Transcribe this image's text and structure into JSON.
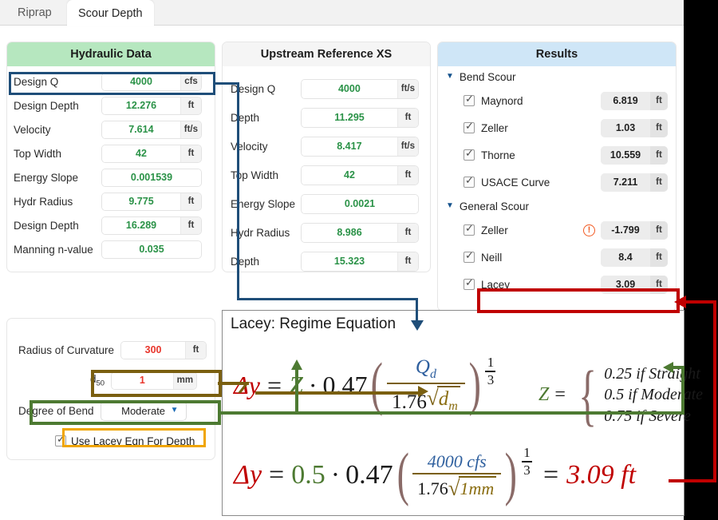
{
  "window": {
    "tabs": [
      {
        "label": "Riprap",
        "active": false
      },
      {
        "label": "Scour Depth",
        "active": true
      }
    ]
  },
  "hydraulic_panel": {
    "title": "Hydraulic Data",
    "header_color": "#b6e7bf",
    "rows": [
      {
        "label": "Design Q",
        "value": "4000",
        "unit": "cfs"
      },
      {
        "label": "Design Depth",
        "value": "12.276",
        "unit": "ft"
      },
      {
        "label": "Velocity",
        "value": "7.614",
        "unit": "ft/s"
      },
      {
        "label": "Top Width",
        "value": "42",
        "unit": "ft"
      },
      {
        "label": "Energy Slope",
        "value": "0.001539",
        "unit": ""
      },
      {
        "label": "Hydr Radius",
        "value": "9.775",
        "unit": "ft"
      },
      {
        "label": "Design Depth",
        "value": "16.289",
        "unit": "ft"
      },
      {
        "label": "Manning n-value",
        "value": "0.035",
        "unit": ""
      }
    ]
  },
  "upstream_panel": {
    "title": "Upstream Reference XS",
    "header_color": "#f5f5f5",
    "rows": [
      {
        "label": "Design Q",
        "value": "4000",
        "unit": "ft/s"
      },
      {
        "label": "Depth",
        "value": "11.295",
        "unit": "ft"
      },
      {
        "label": "Velocity",
        "value": "8.417",
        "unit": "ft/s"
      },
      {
        "label": "Top Width",
        "value": "42",
        "unit": "ft"
      },
      {
        "label": "Energy Slope",
        "value": "0.0021",
        "unit": ""
      },
      {
        "label": "Hydr Radius",
        "value": "8.986",
        "unit": "ft"
      },
      {
        "label": "Depth",
        "value": "15.323",
        "unit": "ft"
      }
    ]
  },
  "results_panel": {
    "title": "Results",
    "header_color": "#cfe6f7",
    "groups": [
      {
        "name": "Bend Scour",
        "expanded": true,
        "items": [
          {
            "label": "Maynord",
            "checked": true,
            "value": "6.819",
            "unit": "ft",
            "warning": false
          },
          {
            "label": "Zeller",
            "checked": true,
            "value": "1.03",
            "unit": "ft",
            "warning": false
          },
          {
            "label": "Thorne",
            "checked": true,
            "value": "10.559",
            "unit": "ft",
            "warning": false
          },
          {
            "label": "USACE Curve",
            "checked": true,
            "value": "7.211",
            "unit": "ft",
            "warning": false
          }
        ]
      },
      {
        "name": "General Scour",
        "expanded": true,
        "items": [
          {
            "label": "Zeller",
            "checked": true,
            "value": "-1.799",
            "unit": "ft",
            "warning": true
          },
          {
            "label": "Neill",
            "checked": true,
            "value": "8.4",
            "unit": "ft",
            "warning": false
          },
          {
            "label": "Lacey",
            "checked": true,
            "value": "3.09",
            "unit": "ft",
            "warning": false
          }
        ]
      }
    ]
  },
  "bend_panel": {
    "radius_label": "Radius of Curvature",
    "radius_value": "300",
    "radius_unit": "ft",
    "d50_label": "d",
    "d50_sub": "50",
    "d50_value": "1",
    "d50_unit": "mm",
    "degree_label": "Degree of Bend",
    "degree_value": "Moderate",
    "degree_options": [
      "Straight",
      "Moderate",
      "Severe"
    ],
    "use_lacey_label": "Use Lacey Eqn For Depth",
    "use_lacey_checked": true
  },
  "equation_panel": {
    "title": "Lacey: Regime Equation",
    "symbolic": {
      "lhs": "Δy",
      "equals": "=",
      "z": "Z",
      "dot": "·",
      "coef": "0.47",
      "numerator": "Q",
      "numerator_sub": "d",
      "denom_coef": "1.76",
      "denom_radicand": "d",
      "denom_radicand_sub": "m",
      "exp_num": "1",
      "exp_den": "3"
    },
    "z_definition": {
      "symbol": "Z",
      "equals": "=",
      "cases": [
        "0.25 if Straight",
        "0.5 if Moderate",
        "0.75 if Severe"
      ]
    },
    "numeric": {
      "lhs": "Δy",
      "equals": "=",
      "z": "0.5",
      "dot": "·",
      "coef": "0.47",
      "numerator": "4000 cfs",
      "denom_coef": "1.76",
      "denom_radicand": "1mm",
      "exp_num": "1",
      "exp_den": "3",
      "result_equals": "=",
      "result": "3.09 ft"
    }
  },
  "annotations": {
    "colors": {
      "design_q_box": "#1f4e79",
      "lacey_result_box": "#c00000",
      "d50_box": "#7a5f10",
      "degree_box": "#4d7a32",
      "use_lacey_box": "#f0a500"
    }
  }
}
